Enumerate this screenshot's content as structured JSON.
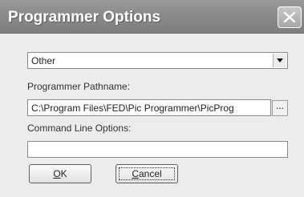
{
  "window": {
    "title": "Programmer Options",
    "close_icon": "close-icon"
  },
  "programmer_select": {
    "value": "Other",
    "arrow_icon": "chevron-down-icon"
  },
  "pathname": {
    "label": "Programmer Pathname:",
    "value": "C:\\Program Files\\FED\\Pic Programmer\\PicProg",
    "browse_label": "..."
  },
  "command_line": {
    "label": "Command Line Options:",
    "value": ""
  },
  "buttons": {
    "ok_mnemonic": "O",
    "ok_rest": "K",
    "cancel_mnemonic": "C",
    "cancel_rest": "ancel"
  }
}
